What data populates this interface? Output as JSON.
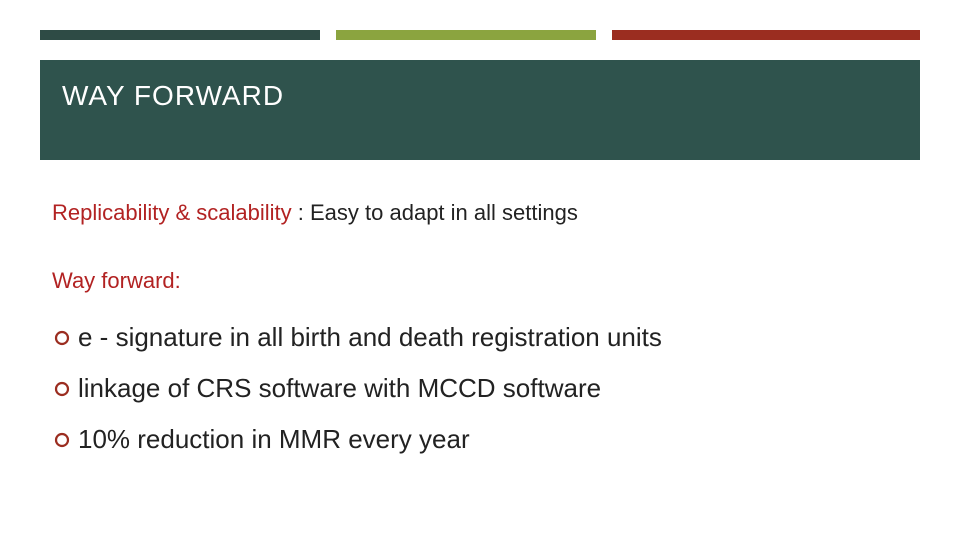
{
  "title": "WAY FORWARD",
  "replicability": {
    "label": "Replicability & scalability",
    "sep": " :  ",
    "text": "Easy to adapt in all settings"
  },
  "way_forward_label": "Way forward:",
  "bullets": [
    "e - signature in all birth and death registration units",
    "linkage of CRS software with MCCD software",
    "10% reduction in MMR every year"
  ],
  "topbar": {
    "seg1_w": 280,
    "gap1_w": 16,
    "seg2_w": 260,
    "gap2_w": 16,
    "seg3_w": 308
  }
}
